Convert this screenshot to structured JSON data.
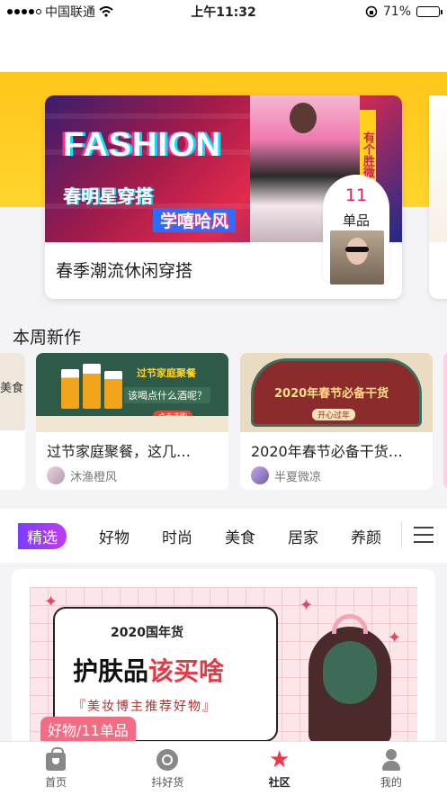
{
  "status_bar": {
    "carrier": "中国联通",
    "time": "上午11:32",
    "battery": "71%",
    "battery_level": 0.71
  },
  "featured": {
    "poster_title": "FASHION",
    "poster_line1": "春明星穿搭",
    "poster_line2": "学嘻哈风",
    "poster_strip": "有个胜微",
    "title": "春季潮流休闲穿搭",
    "item_count": "11",
    "item_label": "单品"
  },
  "new_this_week": {
    "title": "本周新作",
    "left_peek_text": "美食",
    "cards": [
      {
        "title": "过节家庭聚餐，这几…",
        "author": "沐渔橙风",
        "img_text1": "过节家庭聚餐",
        "img_text2": "该喝点什么酒呢？",
        "img_pill": "点击选购"
      },
      {
        "title": "2020年春节必备干货…",
        "author": "半夏微凉",
        "img_text1": "2020年春节必备干货",
        "img_text2": "开心过年"
      }
    ]
  },
  "tabs": {
    "items": [
      "精选",
      "好物",
      "时尚",
      "美食",
      "居家",
      "养颜"
    ],
    "active_index": 0
  },
  "feed": {
    "img_line1": "2020国年货",
    "img_line2_a": "护肤品",
    "img_line2_b": "该买啥",
    "img_line3": "『美妆博主推荐好物』",
    "tag": "好物/11单品"
  },
  "bottom_nav": {
    "items": [
      {
        "label": "首页",
        "icon": "shopping-bag-icon"
      },
      {
        "label": "抖好货",
        "icon": "disc-icon"
      },
      {
        "label": "社区",
        "icon": "star-icon"
      },
      {
        "label": "我的",
        "icon": "user-icon"
      }
    ],
    "active_index": 2
  },
  "colors": {
    "accent": "#e0245e",
    "tab_active_start": "#7b3cff",
    "tab_active_end": "#c13cf0",
    "banner_yellow": "#ffc61a"
  }
}
